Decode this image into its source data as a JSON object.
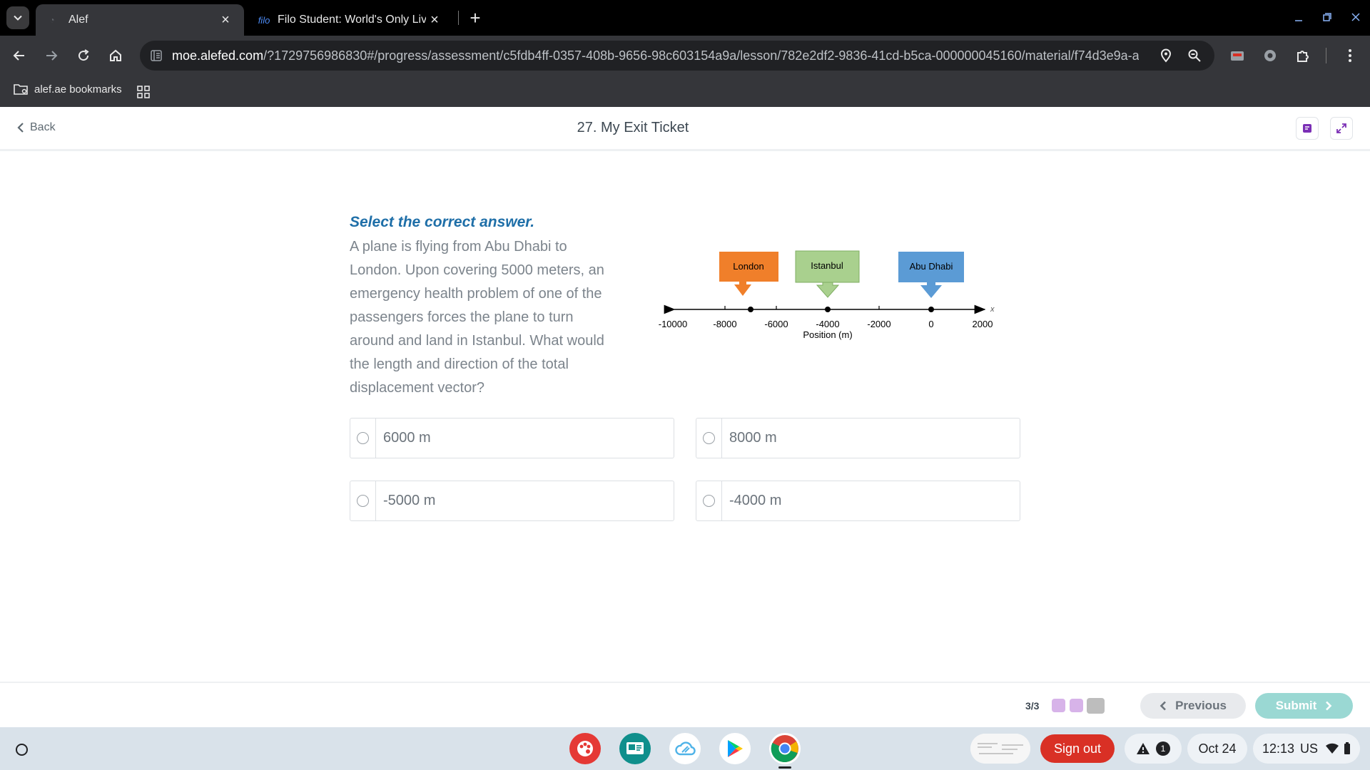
{
  "browser": {
    "tabs": [
      {
        "title": "Alef",
        "active": true
      },
      {
        "favicon_text": "filo",
        "title": "Filo Student: World's Only Live I",
        "active": false
      }
    ],
    "url_host": "moe.alefed.com",
    "url_path": "/?1729756986830#/progress/assessment/c5fdb4ff-0357-408b-9656-98c603154a9a/lesson/782e2df2-9836-41cd-b5ca-000000045160/material/f74d3e9a-a...",
    "bookmarks": [
      {
        "label": "alef.ae bookmarks"
      }
    ]
  },
  "header": {
    "back_label": "Back",
    "title": "27. My Exit Ticket"
  },
  "question": {
    "instruction": "Select the correct answer.",
    "text": "A plane is flying from Abu Dhabi to London. Upon covering 5000 meters, an emergency health problem of one of the passengers forces the plane to turn around and land in Istanbul.  What would the length and direction of the total displacement vector?",
    "options": [
      {
        "label": "6000 m"
      },
      {
        "label": "8000 m"
      },
      {
        "label": "-5000 m"
      },
      {
        "label": "-4000 m"
      }
    ]
  },
  "diagram": {
    "axis_var": "x",
    "axis_title": "Position (m)",
    "ticks": [
      "-10000",
      "-8000",
      "-6000",
      "-4000",
      "-2000",
      "0",
      "2000"
    ],
    "markers": [
      {
        "label": "London",
        "color": "#f07f2a"
      },
      {
        "label": "Istanbul",
        "color": "#a9d08e"
      },
      {
        "label": "Abu Dhabi",
        "color": "#5b9bd5"
      }
    ]
  },
  "footer": {
    "progress": "3/3",
    "progress_colors": [
      "#d7b3e9",
      "#d7b3e9",
      "#bdbdbd"
    ],
    "previous_label": "Previous",
    "submit_label": "Submit"
  },
  "shelf": {
    "signout_label": "Sign out",
    "notification_count": "1",
    "date": "Oct 24",
    "time": "12:13",
    "locale": "US"
  }
}
